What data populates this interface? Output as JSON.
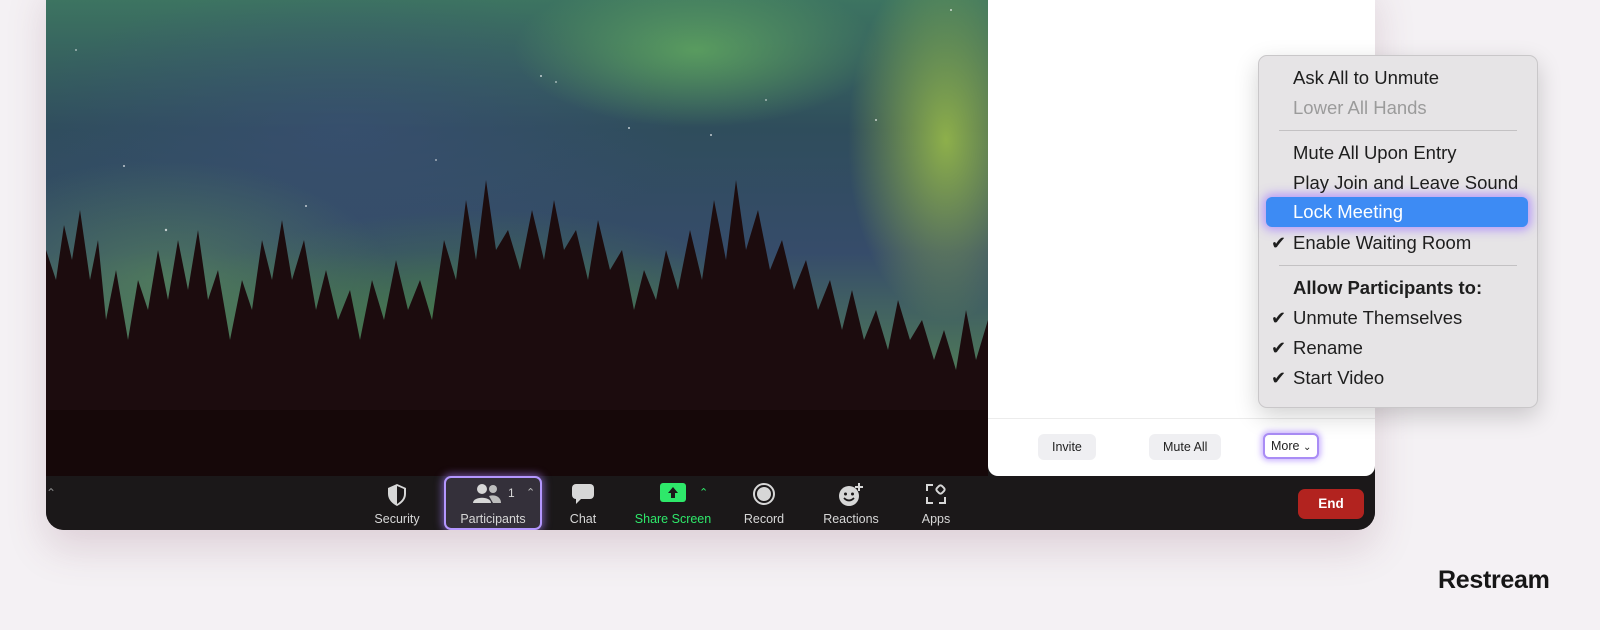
{
  "panel": {
    "invite_label": "Invite",
    "mute_all_label": "Mute All",
    "more_label": "More"
  },
  "toolbar": {
    "security_label": "Security",
    "participants_label": "Participants",
    "participants_count": "1",
    "chat_label": "Chat",
    "share_screen_label": "Share Screen",
    "record_label": "Record",
    "reactions_label": "Reactions",
    "apps_label": "Apps",
    "end_label": "End"
  },
  "menu": {
    "ask_all_unmute": "Ask All to Unmute",
    "lower_all_hands": "Lower All Hands",
    "mute_all_upon_entry": "Mute All Upon Entry",
    "play_join_leave_sound": "Play Join and Leave Sound",
    "lock_meeting": "Lock Meeting",
    "enable_waiting_room": "Enable Waiting Room",
    "allow_participants_heading": "Allow Participants to:",
    "unmute_themselves": "Unmute Themselves",
    "rename": "Rename",
    "start_video": "Start Video"
  },
  "brand": {
    "name": "Restream"
  },
  "colors": {
    "share_screen_green": "#2ee86a",
    "end_red": "#b2231f",
    "menu_highlight": "#3d8bf4",
    "focus_ring": "#b497ff"
  }
}
